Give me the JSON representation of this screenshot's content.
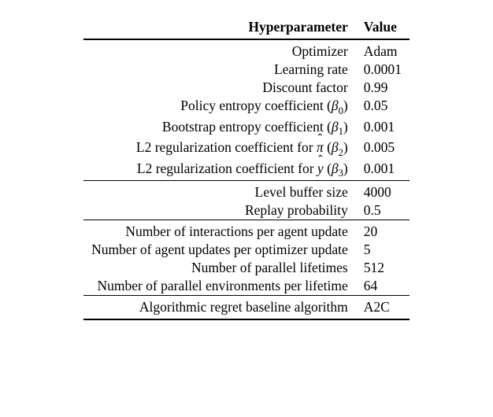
{
  "chart_data": {
    "type": "table",
    "title": "",
    "columns": [
      "Hyperparameter",
      "Value"
    ],
    "groups": [
      {
        "rows": [
          {
            "label_plain": "Optimizer",
            "value": "Adam"
          },
          {
            "label_plain": "Learning rate",
            "value": "0.0001"
          },
          {
            "label_plain": "Discount factor",
            "value": "0.99"
          },
          {
            "label_plain": "Policy entropy coefficient (β0)",
            "value": "0.05"
          },
          {
            "label_plain": "Bootstrap entropy coefficient (β1)",
            "value": "0.001"
          },
          {
            "label_plain": "L2 regularization coefficient for π̂ (β2)",
            "value": "0.005"
          },
          {
            "label_plain": "L2 regularization coefficient for ŷ (β3)",
            "value": "0.001"
          }
        ]
      },
      {
        "rows": [
          {
            "label_plain": "Level buffer size",
            "value": "4000"
          },
          {
            "label_plain": "Replay probability",
            "value": "0.5"
          }
        ]
      },
      {
        "rows": [
          {
            "label_plain": "Number of interactions per agent update",
            "value": "20"
          },
          {
            "label_plain": "Number of agent updates per optimizer update",
            "value": "5"
          },
          {
            "label_plain": "Number of parallel lifetimes",
            "value": "512"
          },
          {
            "label_plain": "Number of parallel environments per lifetime",
            "value": "64"
          }
        ]
      },
      {
        "rows": [
          {
            "label_plain": "Algorithmic regret baseline algorithm",
            "value": "A2C"
          }
        ]
      }
    ]
  },
  "header": {
    "hp": "Hyperparameter",
    "val": "Value"
  },
  "rows": {
    "optimizer": {
      "label": "Optimizer",
      "value": "Adam"
    },
    "lr": {
      "label": "Learning rate",
      "value": "0.0001"
    },
    "discount": {
      "label": "Discount factor",
      "value": "0.99"
    },
    "policy_ent": {
      "label": "Policy entropy coefficient (",
      "sym": "β",
      "sub": "0",
      "tail": ")",
      "value": "0.05"
    },
    "boot_ent": {
      "label": "Bootstrap entropy coefficient (",
      "sym": "β",
      "sub": "1",
      "tail": ")",
      "value": "0.001"
    },
    "l2_pi": {
      "label": "L2 regularization coefficient for ",
      "hat": "π",
      "mid": " (",
      "sym": "β",
      "sub": "2",
      "tail": ")",
      "value": "0.005"
    },
    "l2_y": {
      "label": "L2 regularization coefficient for ",
      "hat": "y",
      "mid": " (",
      "sym": "β",
      "sub": "3",
      "tail": ")",
      "value": "0.001"
    },
    "buffer": {
      "label": "Level buffer size",
      "value": "4000"
    },
    "replay": {
      "label": "Replay probability",
      "value": "0.5"
    },
    "interactions": {
      "label": "Number of interactions per agent update",
      "value": "20"
    },
    "agent_updates": {
      "label": "Number of agent updates per optimizer update",
      "value": "5"
    },
    "lifetimes": {
      "label": "Number of parallel lifetimes",
      "value": "512"
    },
    "envs": {
      "label": "Number of parallel environments per lifetime",
      "value": "64"
    },
    "baseline": {
      "label": "Algorithmic regret baseline algorithm",
      "value": "A2C"
    }
  }
}
